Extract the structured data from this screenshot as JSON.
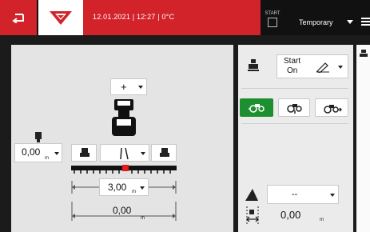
{
  "header": {
    "datetime": "12.01.2021 | 12:27 | 0°C",
    "start_label": "START",
    "profile": "Temporary"
  },
  "left": {
    "side_value": "0,00",
    "side_unit": "m"
  },
  "center": {
    "top_dropdown_value": "+",
    "tool_value": "| \\",
    "spacing_value": "3,00",
    "spacing_unit": "m",
    "width_value": "0,00",
    "width_unit": "m"
  },
  "right": {
    "mode_line1": "Start",
    "mode_line2": "On",
    "position_value": "--",
    "offset_value": "0,00",
    "offset_unit": "m"
  },
  "colors": {
    "brand_red": "#d2232a",
    "active_green": "#1e8f2e",
    "marker_red": "#e21b1b"
  }
}
